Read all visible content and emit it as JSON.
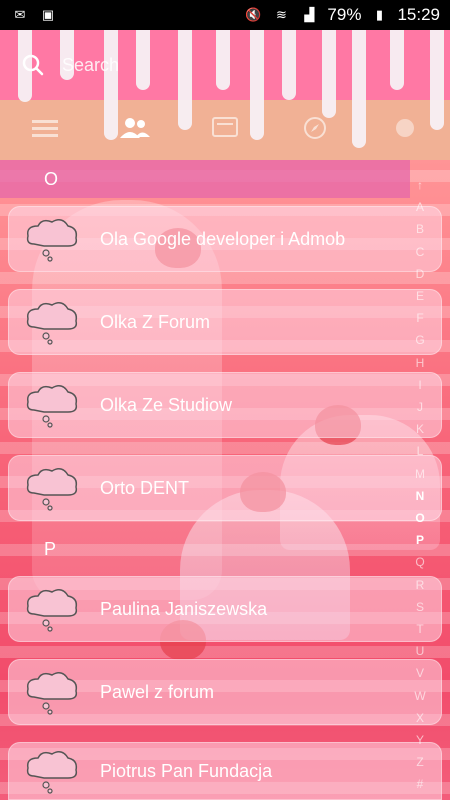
{
  "status_bar": {
    "battery": "79%",
    "time": "15:29",
    "left_icons": [
      "mail-icon",
      "image-icon",
      "doc-icon",
      "box-icon"
    ],
    "right_icons": [
      "mute-icon",
      "wifi-icon",
      "signal-icon",
      "battery-icon"
    ]
  },
  "search": {
    "placeholder": "Search"
  },
  "tabs": [
    {
      "name": "menu",
      "icon": "menu-icon"
    },
    {
      "name": "contacts",
      "icon": "contacts-icon",
      "active": true
    },
    {
      "name": "messages",
      "icon": "message-icon"
    },
    {
      "name": "compass",
      "icon": "compass-icon"
    },
    {
      "name": "favorites",
      "icon": "favorites-icon"
    }
  ],
  "sections": {
    "o": "O",
    "p": "P"
  },
  "contacts": [
    {
      "name": "Ola Google developer i Admob"
    },
    {
      "name": "Olka Z Forum"
    },
    {
      "name": "Olka Ze Studiow"
    },
    {
      "name": "Orto DENT"
    },
    {
      "name": "Paulina Janiszewska"
    },
    {
      "name": "Pawel z forum"
    },
    {
      "name": "Piotrus Pan Fundacja"
    }
  ],
  "alphabet": [
    "↑",
    "A",
    "B",
    "C",
    "D",
    "E",
    "F",
    "G",
    "H",
    "I",
    "J",
    "K",
    "L",
    "M",
    "N",
    "O",
    "P",
    "Q",
    "R",
    "S",
    "T",
    "U",
    "V",
    "W",
    "X",
    "Y",
    "Z",
    "#"
  ],
  "alphabet_active": [
    "N",
    "O",
    "P"
  ],
  "colors": {
    "header_pink": "#ff78a4",
    "header_peach": "#f1b195",
    "section_bar": "#e567aa",
    "bg_main": "#f76e86"
  }
}
